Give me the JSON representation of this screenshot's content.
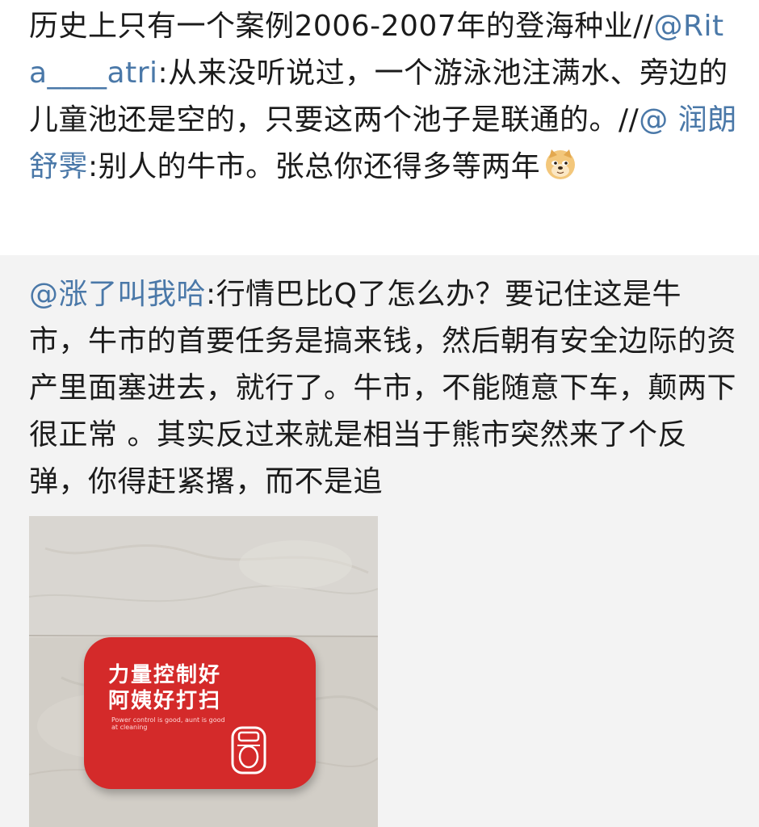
{
  "top_post": {
    "text_before": "历史上只有一个案例2006-2007年的登海种业//",
    "mention_1": "@Rita____atri",
    "text_middle": ":从来没听说过，一个游泳池注满水、旁边的儿童池还是空的，只要这两个池子是联通的。//",
    "mention_2": "@ 润朗舒霁",
    "text_after": ":别人的牛市。张总你还得多等两年",
    "emoji": "doge-emoji"
  },
  "repost": {
    "mention": "@涨了叫我哈",
    "text": ":行情巴比Q了怎么办？要记住这是牛市，牛市的首要任务是搞来钱，然后朝有安全边际的资产里面塞进去，就行了。牛市，不能随意下车，颠两下很正常 。其实反过来就是相当于熊市突然来了个反弹，你得赶紧撂，而不是追"
  },
  "image": {
    "sign_line_1": "力量控制好",
    "sign_line_2": "阿姨好打扫",
    "sign_english": "Power control is good, aunt is good at cleaning",
    "icon": "toilet-icon"
  },
  "colors": {
    "mention": "#4a78a8",
    "repost_bg": "#f3f3f3",
    "sign_red": "#d42a2a"
  }
}
